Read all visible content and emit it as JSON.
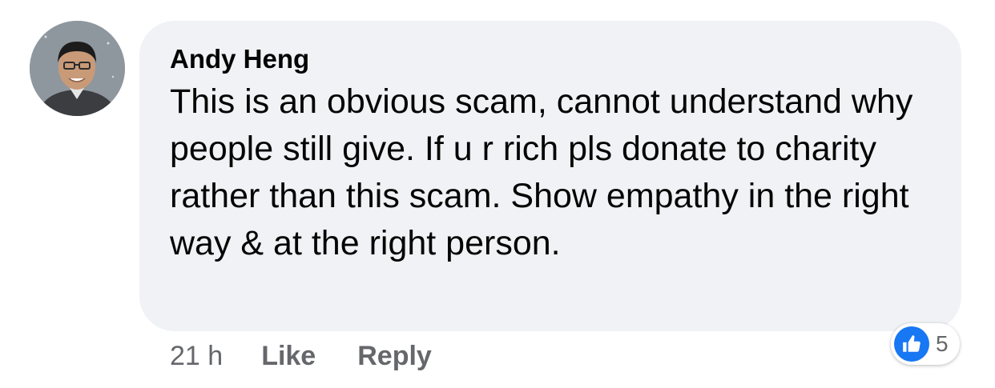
{
  "comment": {
    "author": "Andy Heng",
    "text": "This is an obvious scam, cannot understand why people still give. If u r rich pls donate to charity rather than this scam. Show empathy in the right way & at the right person.",
    "timestamp": "21 h",
    "like_label": "Like",
    "reply_label": "Reply",
    "reaction_count": "5",
    "reaction_icon": "thumbs-up-icon"
  },
  "colors": {
    "bubble": "#f0f2f5",
    "text": "#050505",
    "secondary": "#65676b",
    "like_blue": "#1877f2"
  }
}
